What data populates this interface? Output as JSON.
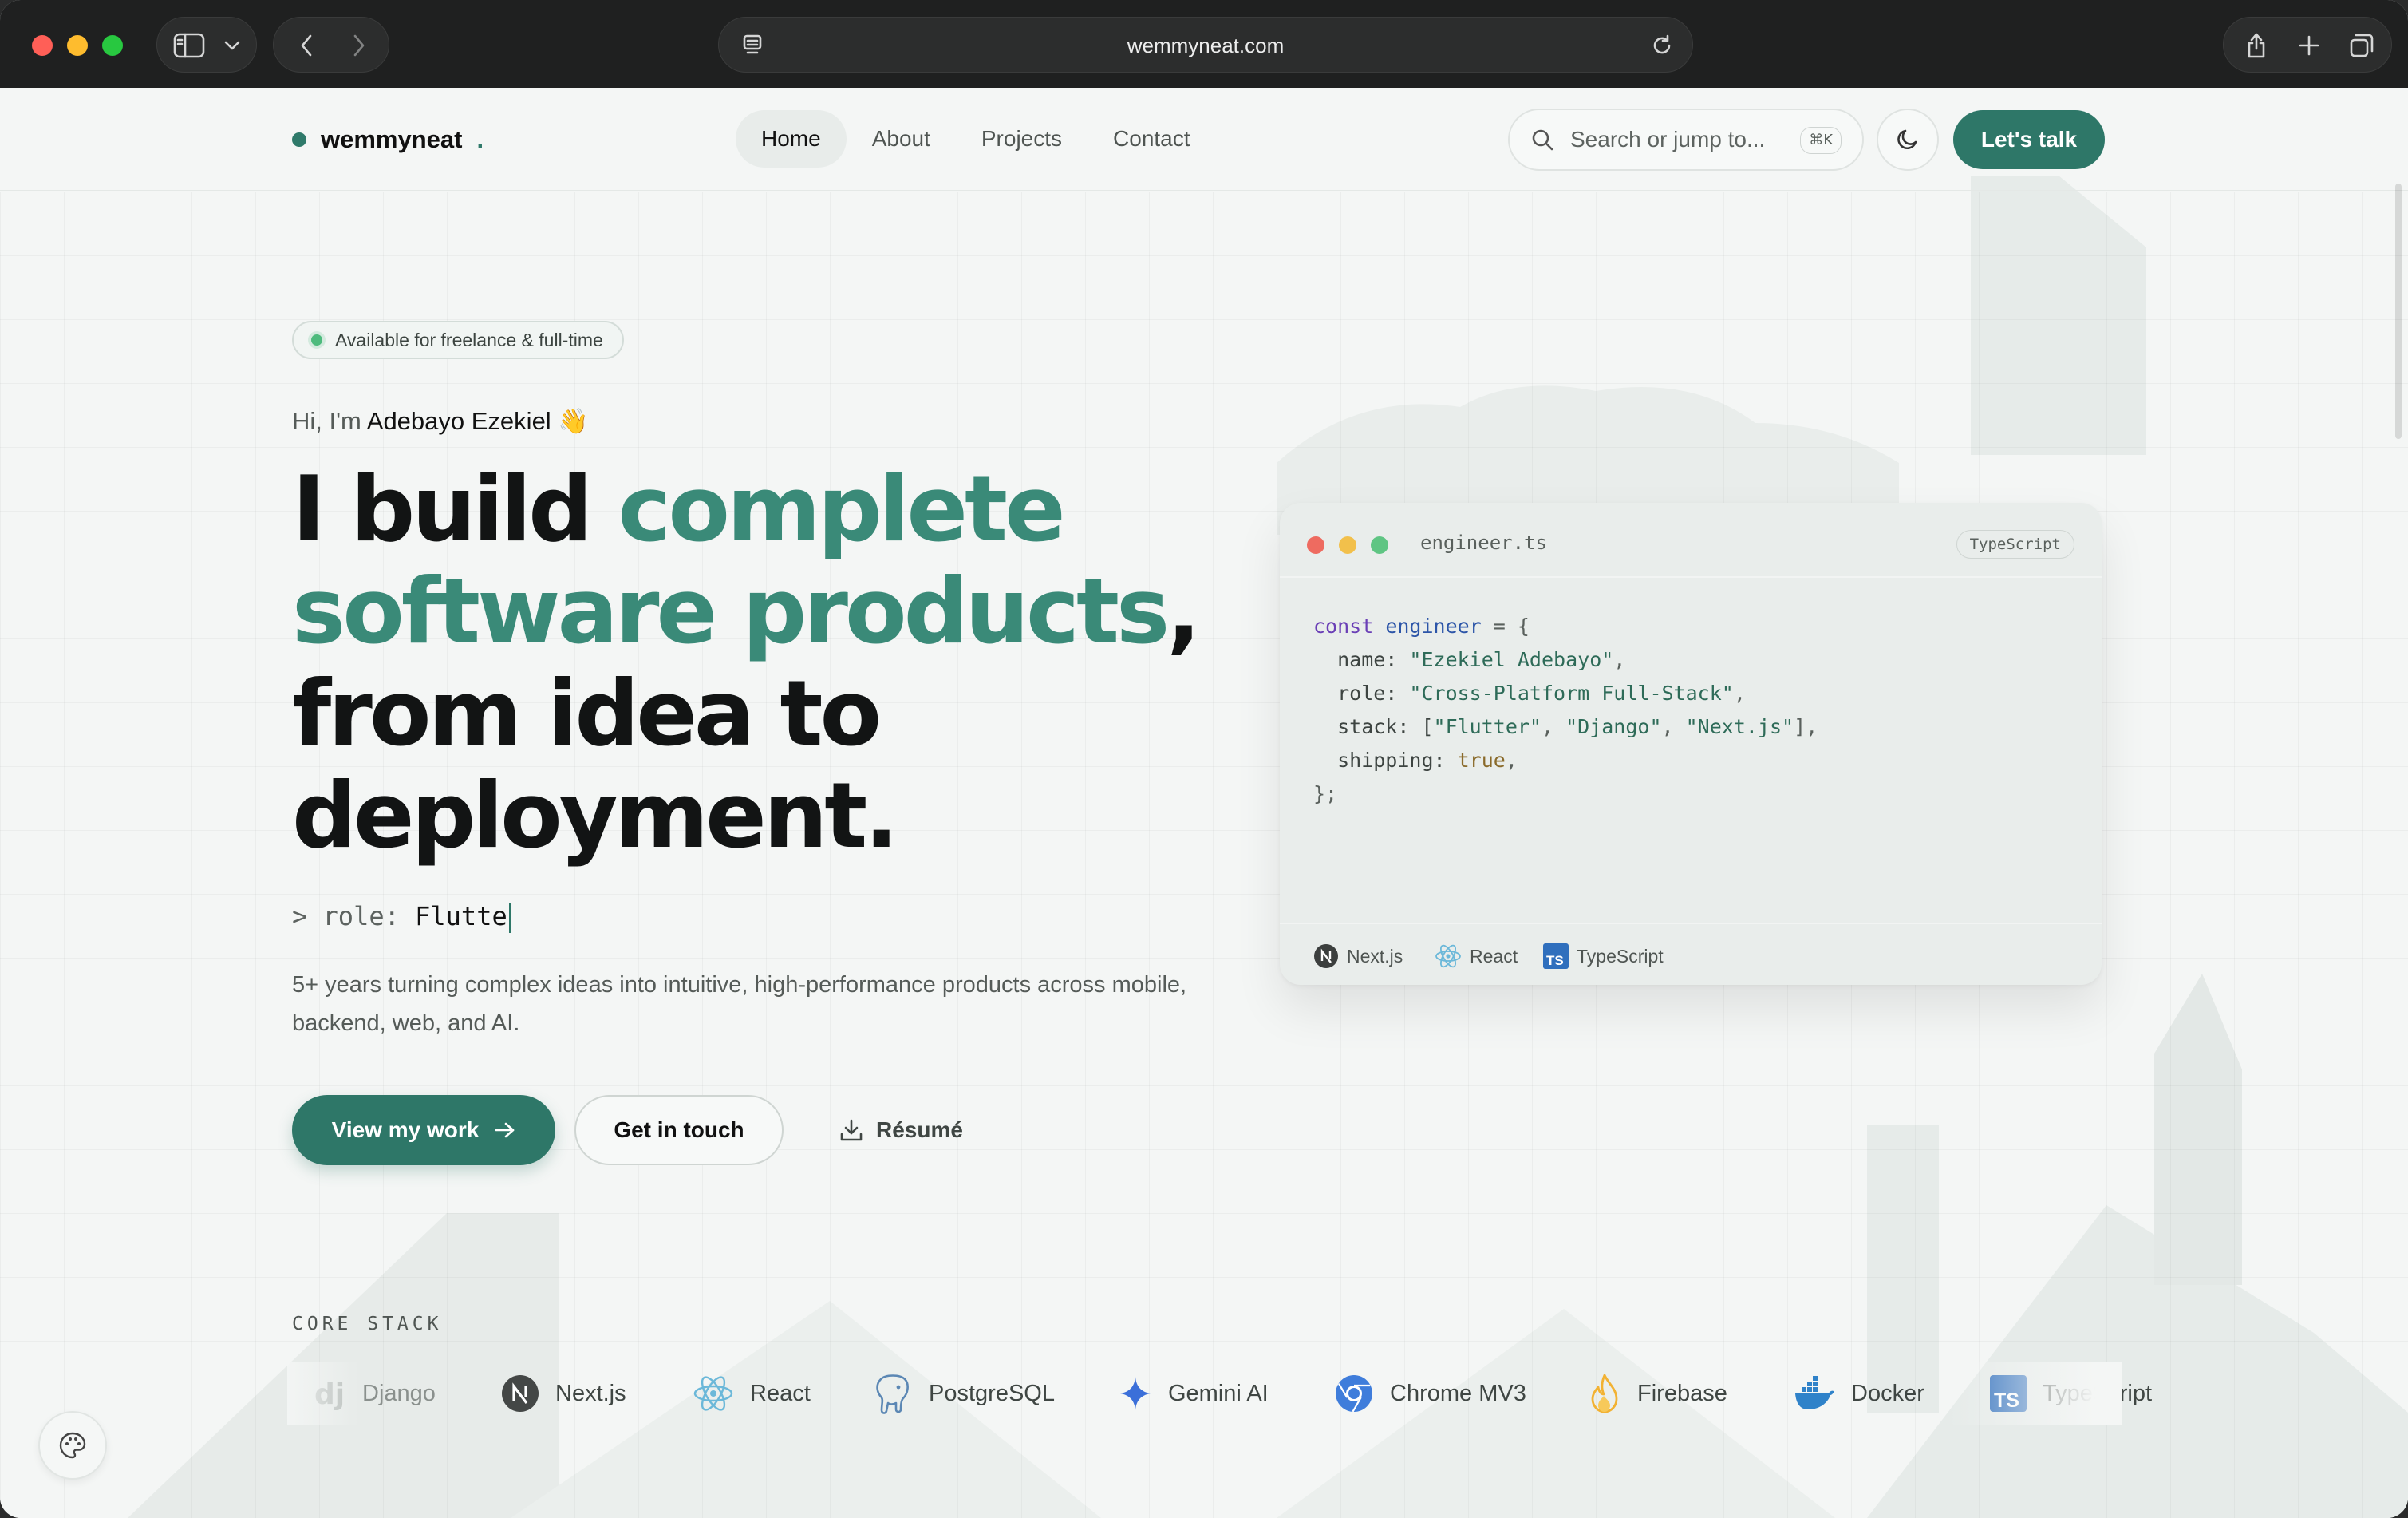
{
  "browser": {
    "url": "wemmyneat.com"
  },
  "nav": {
    "brand": "wemmyneat",
    "brand_suffix": ".",
    "items": [
      {
        "label": "Home",
        "active": true
      },
      {
        "label": "About",
        "active": false
      },
      {
        "label": "Projects",
        "active": false
      },
      {
        "label": "Contact",
        "active": false
      }
    ],
    "search_placeholder": "Search or jump to...",
    "search_shortcut": "⌘K",
    "cta": "Let's talk"
  },
  "hero": {
    "badge": "Available for freelance & full-time",
    "greeting_prefix": "Hi, I'm ",
    "name": "Adebayo Ezekiel",
    "greeting_emoji": "👋",
    "headline_1": "I build ",
    "headline_accent_1": "complete",
    "headline_accent_2": "software products",
    "headline_2": ",",
    "headline_3": "from idea to",
    "headline_4": "deployment.",
    "role_prefix": "> role: ",
    "role_value": "Flutte",
    "description": "5+ years turning complex ideas into intuitive, high-performance products across mobile, backend, web, and AI.",
    "primary_cta": "View my work",
    "secondary_cta": "Get in touch",
    "resume": "Résumé"
  },
  "code_card": {
    "filename": "engineer.ts",
    "language": "TypeScript",
    "tokens": {
      "const": "const",
      "var": "engineer",
      "open": " = {",
      "name_key": "  name: ",
      "name_val": "\"Ezekiel Adebayo\"",
      "role_key": "  role: ",
      "role_val": "\"Cross-Platform Full-Stack\"",
      "stack_key": "  stack: [",
      "stack_1": "\"Flutter\"",
      "stack_2": "\"Django\"",
      "stack_3": "\"Next.js\"",
      "ship_key": "  shipping: ",
      "ship_val": "true",
      "close": "};"
    },
    "footer": [
      "Next.js",
      "React",
      "TypeScript"
    ]
  },
  "core_stack": {
    "label": "CORE STACK",
    "items": [
      "Django",
      "Next.js",
      "React",
      "PostgreSQL",
      "Gemini AI",
      "Chrome MV3",
      "Firebase",
      "Docker",
      "TypeScript"
    ]
  },
  "colors": {
    "accent": "#2e7768",
    "accent_text": "#3a8a78",
    "background": "#f4f6f5"
  }
}
